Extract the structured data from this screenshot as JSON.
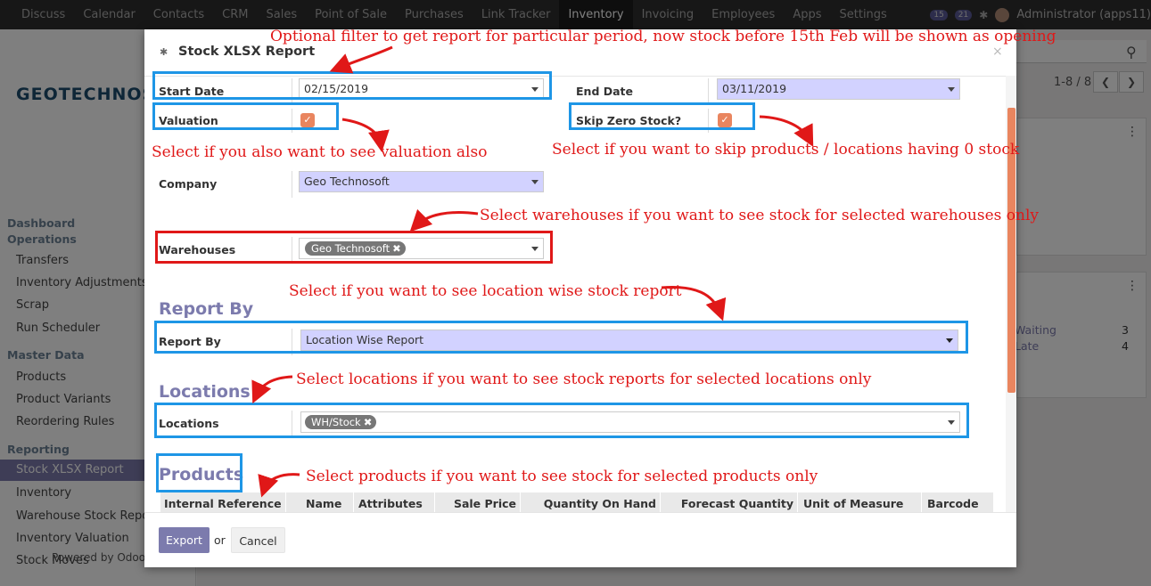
{
  "topnav": {
    "items": [
      "Discuss",
      "Calendar",
      "Contacts",
      "CRM",
      "Sales",
      "Point of Sale",
      "Purchases",
      "Link Tracker",
      "Inventory",
      "Invoicing",
      "Employees",
      "Apps",
      "Settings"
    ],
    "active": "Inventory",
    "badge_messages": "15",
    "badge_activities": "21",
    "user": "Administrator (apps11)"
  },
  "sidebar": {
    "logo": "GEOTECHNOSO",
    "sections": [
      {
        "title": "Dashboard Operations"
      },
      {
        "title": "Master Data"
      },
      {
        "title": "Reporting"
      }
    ],
    "operations": [
      "Transfers",
      "Inventory Adjustments",
      "Scrap",
      "Run Scheduler"
    ],
    "master_data": [
      "Products",
      "Product Variants",
      "Reordering Rules"
    ],
    "reporting": [
      "Stock XLSX Report",
      "Inventory",
      "Warehouse Stock Report",
      "Inventory Valuation",
      "Stock Moves"
    ],
    "active_item": "Stock XLSX Report",
    "powered_by": "Powered by Odoo"
  },
  "background": {
    "pager": "1-8 / 8",
    "card_rows": [
      {
        "label": "Waiting",
        "count": "3"
      },
      {
        "label": "Late",
        "count": "4"
      }
    ]
  },
  "modal": {
    "title": "Stock XLSX Report",
    "close": "×",
    "start_date_label": "Start Date",
    "start_date": "02/15/2019",
    "end_date_label": "End Date",
    "end_date": "03/11/2019",
    "valuation_label": "Valuation",
    "valuation_checked": true,
    "skip_zero_label": "Skip Zero Stock?",
    "skip_zero_checked": true,
    "company_label": "Company",
    "company": "Geo Technosoft",
    "warehouses_label": "Warehouses",
    "warehouse_tag": "Geo Technosoft",
    "report_by_section": "Report By",
    "report_by_label": "Report By",
    "report_by": "Location Wise Report",
    "locations_section": "Locations",
    "locations_label": "Locations",
    "location_tag": "WH/Stock",
    "products_section": "Products",
    "product_columns": [
      "Internal Reference",
      "Name",
      "Attributes",
      "Sale Price",
      "Quantity On Hand",
      "Forecast Quantity",
      "Unit of Measure",
      "Barcode"
    ],
    "export_label": "Export",
    "or_label": "or",
    "cancel_label": "Cancel"
  },
  "annotations": {
    "period": "Optional filter to get report for particular period, now stock before 15th Feb will be shown as opening",
    "valuation": "Select if you also want to see valuation also",
    "skip_zero": "Select if you want to skip products / locations having 0 stock",
    "warehouses": "Select warehouses if you want to see stock for selected warehouses only",
    "location_wise": "Select if you want to see location wise stock report",
    "locations": "Select locations if you want to see stock reports for selected locations only",
    "products": "Select products if you want to see stock for selected products only",
    "color": "#e01818",
    "highlight_color": "#1e96e6"
  }
}
